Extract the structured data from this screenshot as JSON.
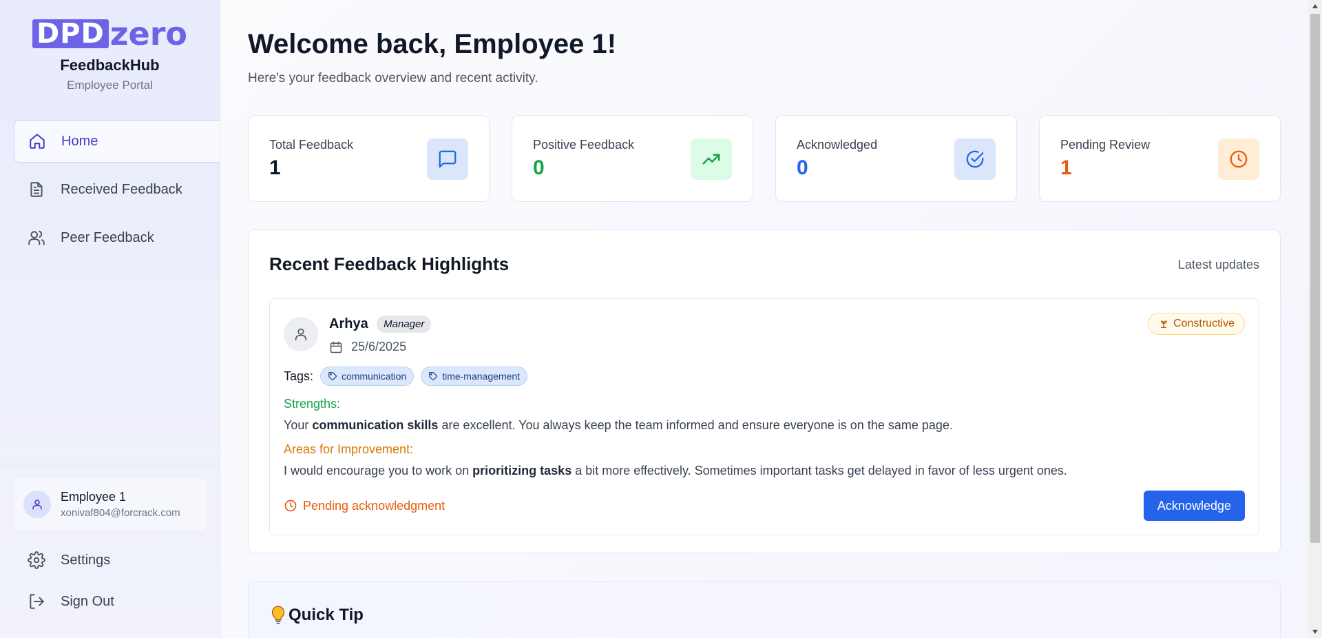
{
  "sidebar": {
    "logo": {
      "part1": "DPD",
      "part2": "zero"
    },
    "app_name": "FeedbackHub",
    "app_sub": "Employee Portal",
    "nav": [
      {
        "label": "Home",
        "icon": "home-icon",
        "active": true
      },
      {
        "label": "Received Feedback",
        "icon": "document-icon",
        "active": false
      },
      {
        "label": "Peer Feedback",
        "icon": "users-icon",
        "active": false
      }
    ],
    "user": {
      "name": "Employee 1",
      "email": "xonivaf804@forcrack.com"
    },
    "settings_label": "Settings",
    "signout_label": "Sign Out"
  },
  "main": {
    "title": "Welcome back, Employee 1!",
    "subtitle": "Here's your feedback overview and recent activity.",
    "stats": [
      {
        "label": "Total Feedback",
        "value": "1",
        "color": "#111827",
        "icon": "message-square-icon",
        "icon_bg": "#dbe6fb",
        "icon_color": "#2563eb"
      },
      {
        "label": "Positive Feedback",
        "value": "0",
        "color": "#16a34a",
        "icon": "trending-up-icon",
        "icon_bg": "#dcfce7",
        "icon_color": "#16a34a"
      },
      {
        "label": "Acknowledged",
        "value": "0",
        "color": "#2563eb",
        "icon": "check-circle-icon",
        "icon_bg": "#dbe6fb",
        "icon_color": "#2563eb"
      },
      {
        "label": "Pending Review",
        "value": "1",
        "color": "#ea580c",
        "icon": "clock-icon",
        "icon_bg": "#ffedd5",
        "icon_color": "#ea580c"
      }
    ],
    "highlights": {
      "title": "Recent Feedback Highlights",
      "right_label": "Latest updates",
      "card": {
        "name": "Arhya",
        "role": "Manager",
        "date": "25/6/2025",
        "type": "Constructive",
        "tags_label": "Tags:",
        "tags": [
          "communication",
          "time-management"
        ],
        "strengths_label": "Strengths:",
        "strengths_pre": "Your ",
        "strengths_bold": "communication skills",
        "strengths_post": " are excellent. You always keep the team informed and ensure everyone is on the same page.",
        "improve_label": "Areas for Improvement:",
        "improve_pre": "I would encourage you to work on ",
        "improve_bold": "prioritizing tasks",
        "improve_post": " a bit more effectively. Sometimes important tasks get delayed in favor of less urgent ones.",
        "status": "Pending acknowledgment",
        "button": "Acknowledge"
      }
    },
    "tip": {
      "title": "Quick Tip"
    }
  },
  "colors": {
    "accent": "#4338ca",
    "brand": "#6d63e6",
    "primary_button": "#2563eb"
  }
}
